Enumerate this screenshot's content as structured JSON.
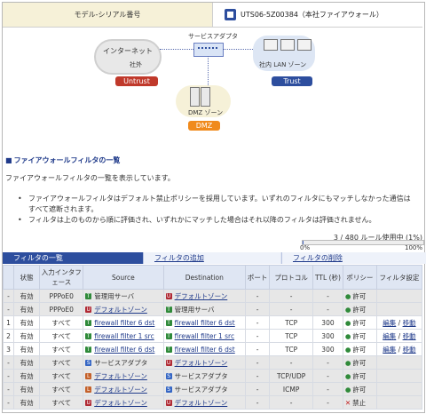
{
  "model": {
    "label": "モデル-シリアル番号",
    "value": "UTS06-5Z00384（本社ファイアウォール）"
  },
  "diagram": {
    "internet_label": "インターネット",
    "outside_label": "社外",
    "adapter_label": "サービスアダプタ",
    "lan_label": "社内 LAN ゾーン",
    "dmz_label": "DMZ ゾーン",
    "untrust_badge": "Untrust",
    "trust_badge": "Trust",
    "dmz_badge": "DMZ",
    "colors": {
      "untrust": "#c0392b",
      "trust": "#2d4e9e",
      "dmz": "#f08a1c"
    }
  },
  "section": {
    "title": "ファイアウォールフィルタの一覧",
    "description": "ファイアウォールフィルタの一覧を表示しています。",
    "notes": [
      "ファイアウォールフィルタはデフォルト禁止ポリシーを採用しています。いずれのフィルタにもマッチしなかった通信はすべて遮断されます。",
      "フィルタは上のものから順に評価され、いずれかにマッチした場合はそれ以降のフィルタは評価されません。"
    ]
  },
  "usage": {
    "text": "3 / 480 ルール使用中 (1%)",
    "min": "0%",
    "max": "100%",
    "fraction": 0.01
  },
  "tabs": {
    "list": "フィルタの一覧",
    "add": "フィルタの追加",
    "delete": "フィルタの削除"
  },
  "table": {
    "headers": [
      "",
      "状態",
      "入力インタフェース",
      "Source",
      "Destination",
      "ポート",
      "プロトコル",
      "TTL (秒)",
      "ポリシー",
      "フィルタ設定"
    ],
    "rows": [
      {
        "no": "-",
        "status": "有効",
        "iface": "PPPoE0",
        "src_icon": "T",
        "src": "管理用サーバ",
        "src_link": false,
        "dst_icon": "U",
        "dst": "デフォルトゾーン",
        "dst_link": true,
        "port": "-",
        "proto": "-",
        "ttl": "-",
        "policy": "許可",
        "policy_ok": true,
        "edit": "",
        "move": "",
        "shade": "gray"
      },
      {
        "no": "-",
        "status": "有効",
        "iface": "PPPoE0",
        "src_icon": "U",
        "src": "デフォルトゾーン",
        "src_link": true,
        "dst_icon": "T",
        "dst": "管理用サーバ",
        "dst_link": false,
        "port": "-",
        "proto": "-",
        "ttl": "-",
        "policy": "許可",
        "policy_ok": true,
        "edit": "",
        "move": "",
        "shade": "gray"
      },
      {
        "no": "1",
        "status": "有効",
        "iface": "すべて",
        "src_icon": "T",
        "src": "firewall filter 6 dst",
        "src_link": true,
        "dst_icon": "T",
        "dst": "firewall filter 6 dst",
        "dst_link": true,
        "port": "-",
        "proto": "TCP",
        "ttl": "300",
        "policy": "許可",
        "policy_ok": true,
        "edit": "編集",
        "move": "移動",
        "shade": "white"
      },
      {
        "no": "2",
        "status": "有効",
        "iface": "すべて",
        "src_icon": "T",
        "src": "firewall filter 1 src",
        "src_link": true,
        "dst_icon": "T",
        "dst": "firewall filter 1 src",
        "dst_link": true,
        "port": "-",
        "proto": "TCP",
        "ttl": "300",
        "policy": "許可",
        "policy_ok": true,
        "edit": "編集",
        "move": "移動",
        "shade": "white"
      },
      {
        "no": "3",
        "status": "有効",
        "iface": "すべて",
        "src_icon": "T",
        "src": "firewall filter 6 dst",
        "src_link": true,
        "dst_icon": "T",
        "dst": "firewall filter 6 dst",
        "dst_link": true,
        "port": "-",
        "proto": "TCP",
        "ttl": "300",
        "policy": "許可",
        "policy_ok": true,
        "edit": "編集",
        "move": "移動",
        "shade": "white"
      },
      {
        "no": "-",
        "status": "有効",
        "iface": "すべて",
        "src_icon": "S",
        "src": "サービスアダプタ",
        "src_link": false,
        "dst_icon": "U",
        "dst": "デフォルトゾーン",
        "dst_link": true,
        "port": "-",
        "proto": "-",
        "ttl": "-",
        "policy": "許可",
        "policy_ok": true,
        "edit": "",
        "move": "",
        "shade": "gray"
      },
      {
        "no": "-",
        "status": "有効",
        "iface": "すべて",
        "src_icon": "L",
        "src": "デフォルトゾーン",
        "src_link": true,
        "dst_icon": "S",
        "dst": "サービスアダプタ",
        "dst_link": false,
        "port": "-",
        "proto": "TCP/UDP",
        "ttl": "-",
        "policy": "許可",
        "policy_ok": true,
        "edit": "",
        "move": "",
        "shade": "gray"
      },
      {
        "no": "-",
        "status": "有効",
        "iface": "すべて",
        "src_icon": "L",
        "src": "デフォルトゾーン",
        "src_link": true,
        "dst_icon": "S",
        "dst": "サービスアダプタ",
        "dst_link": false,
        "port": "-",
        "proto": "ICMP",
        "ttl": "-",
        "policy": "許可",
        "policy_ok": true,
        "edit": "",
        "move": "",
        "shade": "gray"
      },
      {
        "no": "-",
        "status": "有効",
        "iface": "すべて",
        "src_icon": "U",
        "src": "デフォルトゾーン",
        "src_link": true,
        "dst_icon": "U",
        "dst": "デフォルトゾーン",
        "dst_link": true,
        "port": "-",
        "proto": "-",
        "ttl": "-",
        "policy": "禁止",
        "policy_ok": false,
        "edit": "",
        "move": "",
        "shade": "gray"
      }
    ]
  }
}
